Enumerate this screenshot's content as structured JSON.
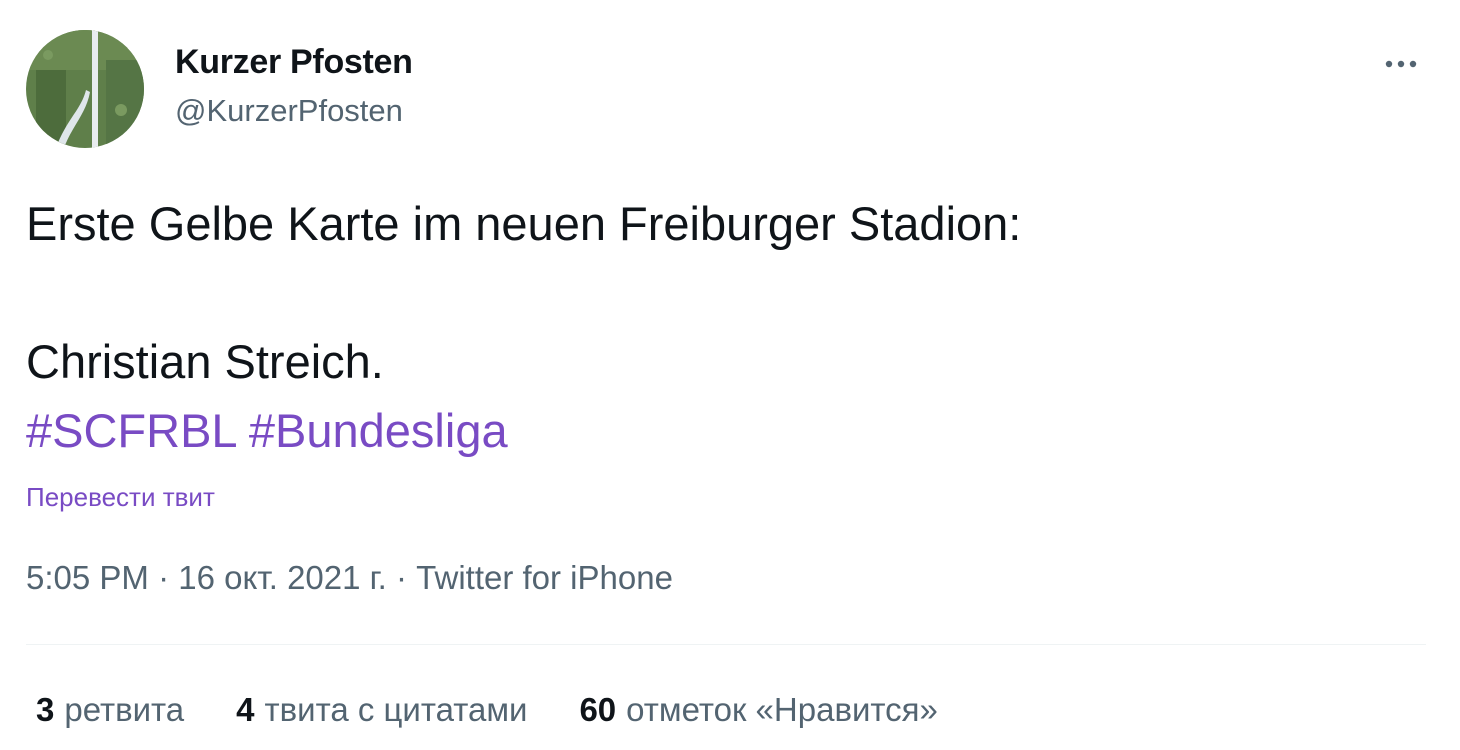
{
  "author": {
    "display_name": "Kurzer Pfosten",
    "handle": "@KurzerPfosten",
    "avatar_icon": "avatar-aerial-field-image"
  },
  "menu": {
    "more_icon": "more-horizontal-icon"
  },
  "tweet": {
    "line1": "Erste Gelbe Karte im neuen Freiburger Stadion:",
    "line2": "Christian Streich.",
    "hashtags": [
      "#SCFRBL",
      "#Bundesliga"
    ]
  },
  "translate_label": "Перевести твит",
  "meta": {
    "time": "5:05 PM",
    "separator": " · ",
    "date": "16 окт. 2021 г.",
    "source": "Twitter for iPhone"
  },
  "stats": {
    "retweets": {
      "count": "3",
      "label": "ретвита"
    },
    "quotes": {
      "count": "4",
      "label": "твита с цитатами"
    },
    "likes": {
      "count": "60",
      "label": "отметок «Нравится»"
    }
  },
  "colors": {
    "text": "#0f1419",
    "secondary": "#536471",
    "accent": "#794bc4",
    "divider": "#eff3f4"
  }
}
